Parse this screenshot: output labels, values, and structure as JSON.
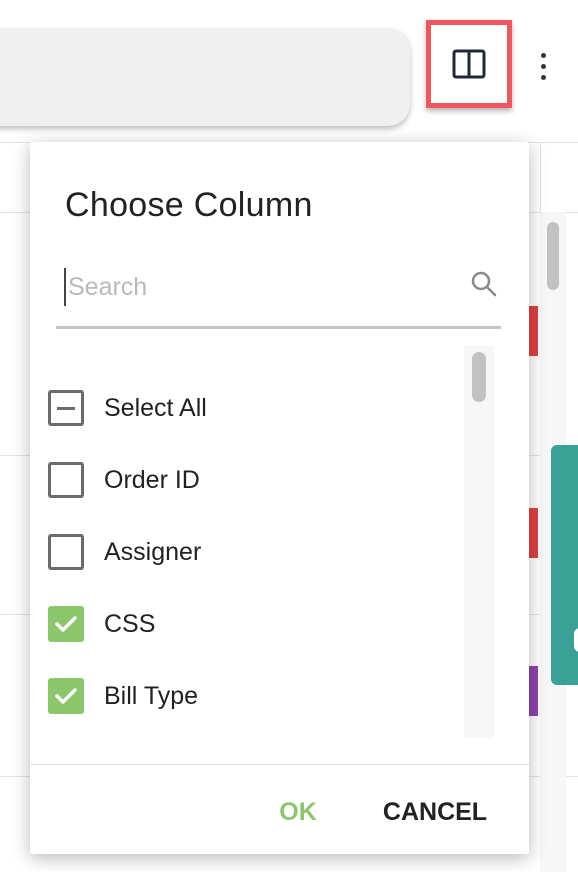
{
  "dialog": {
    "title": "Choose Column",
    "search": {
      "placeholder": "Search",
      "value": ""
    },
    "items": [
      {
        "label": "Select All",
        "state": "indeterminate"
      },
      {
        "label": "Order ID",
        "state": "unchecked"
      },
      {
        "label": "Assigner",
        "state": "unchecked"
      },
      {
        "label": "CSS",
        "state": "checked"
      },
      {
        "label": "Bill Type",
        "state": "checked"
      }
    ],
    "ok_label": "OK",
    "cancel_label": "CANCEL"
  },
  "toolbar": {
    "columns_icon": "columns-icon",
    "more_icon": "more-vertical-icon",
    "highlight_color": "#f0565a"
  },
  "colors": {
    "checked": "#8cc66a",
    "ok_text": "#8cc66a",
    "teal_panel": "#3aa197",
    "tag_red": "#e04040",
    "tag_purple": "#8e44ad"
  }
}
